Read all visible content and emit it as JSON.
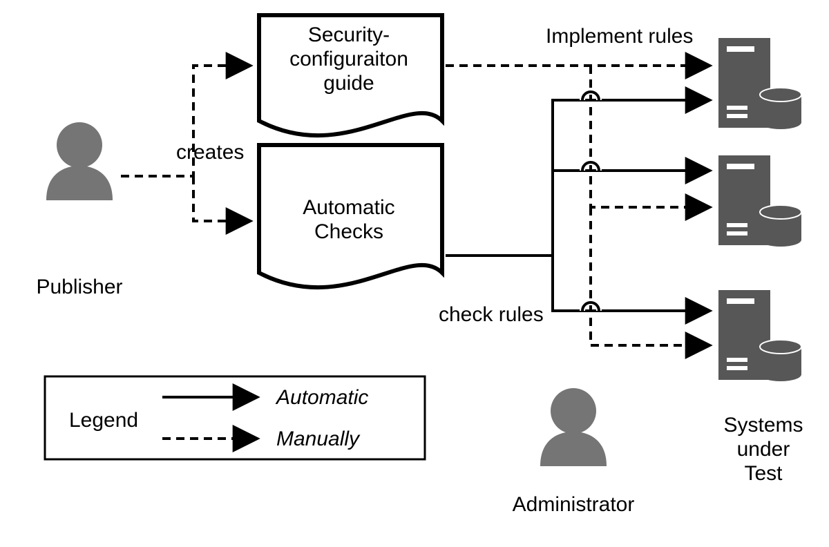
{
  "actors": {
    "publisher": "Publisher",
    "administrator": "Administrator"
  },
  "documents": {
    "guide_line1": "Security-",
    "guide_line2": "configuraiton",
    "guide_line3": "guide",
    "checks_line1": "Automatic",
    "checks_line2": "Checks"
  },
  "edges": {
    "creates": "creates",
    "implement": "Implement rules",
    "check": "check rules"
  },
  "systems": {
    "label_line1": "Systems",
    "label_line2": "under",
    "label_line3": "Test"
  },
  "legend": {
    "title": "Legend",
    "automatic": "Automatic",
    "manually": "Manually"
  }
}
